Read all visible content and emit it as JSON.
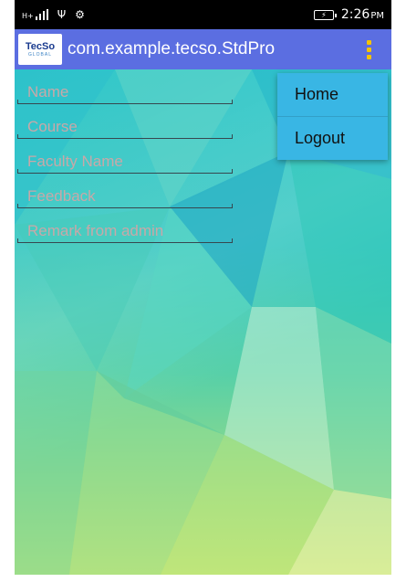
{
  "status_bar": {
    "network_type": "H+",
    "time": "2:26",
    "ampm": "PM"
  },
  "app_bar": {
    "logo_text": "TecSo",
    "logo_subtext": "GLOBAL",
    "title": "com.example.tecso.StdPro"
  },
  "form": {
    "fields": [
      {
        "placeholder": "Name",
        "value": ""
      },
      {
        "placeholder": "Course",
        "value": ""
      },
      {
        "placeholder": "Faculty Name",
        "value": ""
      },
      {
        "placeholder": "Feedback",
        "value": ""
      },
      {
        "placeholder": "Remark from admin",
        "value": ""
      }
    ]
  },
  "menu": {
    "items": [
      {
        "label": "Home"
      },
      {
        "label": "Logout"
      }
    ]
  },
  "colors": {
    "app_bar": "#5b6ee1",
    "menu_bg": "#39b6e4",
    "overflow_dots": "#f4c400"
  }
}
